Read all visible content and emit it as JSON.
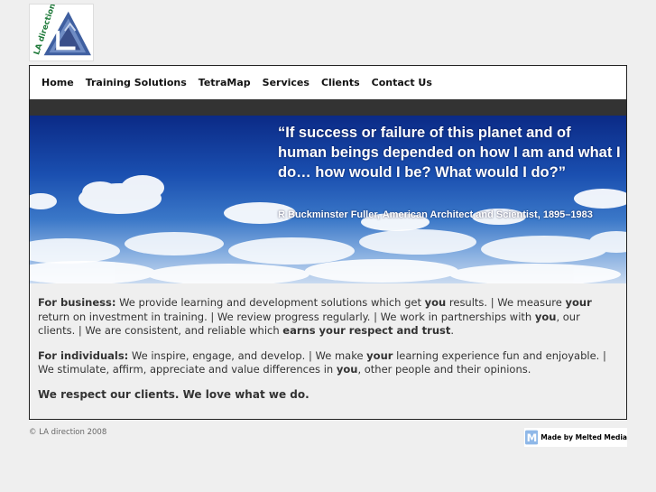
{
  "logo": {
    "text": "LA direction"
  },
  "nav": {
    "items": [
      {
        "label": "Home"
      },
      {
        "label": "Training Solutions"
      },
      {
        "label": "TetraMap"
      },
      {
        "label": "Services"
      },
      {
        "label": "Clients"
      },
      {
        "label": "Contact Us"
      }
    ]
  },
  "banner": {
    "quote": "“If success or failure of this planet and of human beings depended on how I am and what I do… how would I be?  What would I do?”",
    "attribution": "R Buckminster Fuller, American Architect and Scientist, 1895–1983"
  },
  "content": {
    "business": {
      "label": "For business:",
      "t1": " We provide learning and development solutions which get ",
      "b1": "you",
      "t2": " results. | We measure ",
      "b2": "your",
      "t3": " return on investment in training. | We review progress regularly. | We work in partnerships with ",
      "b3": "you",
      "t4": ", our clients. | We are consistent, and reliable which ",
      "b4": "earns your respect and trust",
      "t5": "."
    },
    "individuals": {
      "label": "For individuals:",
      "t1": " We inspire, engage, and develop. | We make ",
      "b1": "your",
      "t2": " learning experience fun and enjoyable. | We stimulate, affirm, appreciate and value differences in ",
      "b2": "you",
      "t3": ", other people and their opinions."
    },
    "tagline": "We respect our clients. We love what we do."
  },
  "footer": {
    "copyright": "© LA direction 2008",
    "madeby": "Made by Melted Media"
  }
}
